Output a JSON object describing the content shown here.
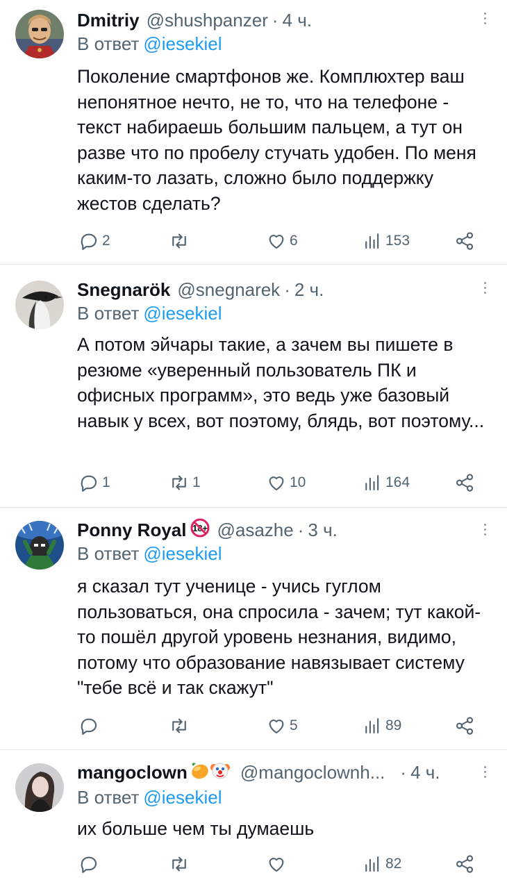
{
  "tweets": [
    {
      "name": "Dmitriy",
      "handle": "@shushpanzer",
      "separator": "·",
      "time": "4 ч.",
      "reply_prefix": "В ответ",
      "reply_mention": "@iesekiel",
      "text": "Поколение смартфонов же. Комплюхтер ваш непонятное нечто, не то, что на телефоне - текст набираешь большим пальцем, а тут он разве что по пробелу стучать удобен. По меня каким-то лазать, сложно было поддержку жестов сделать?",
      "replies": "2",
      "retweets": "",
      "likes": "6",
      "views": "153"
    },
    {
      "name": "Snegnarök",
      "handle": "@snegnarek",
      "separator": "·",
      "time": "2 ч.",
      "reply_prefix": "В ответ",
      "reply_mention": "@iesekiel",
      "text": "А потом эйчары такие, а зачем вы пишете в резюме «уверенный пользователь ПК и офисных программ», это ведь уже базовый навык у всех, вот поэтому, блядь, вот поэтому...",
      "replies": "1",
      "retweets": "1",
      "likes": "10",
      "views": "164"
    },
    {
      "name": "Ponny Royal",
      "badge": "18+",
      "handle": "@asazhe",
      "separator": "·",
      "time": "3 ч.",
      "reply_prefix": "В ответ",
      "reply_mention": "@iesekiel",
      "text": "я сказал тут ученице - учись гуглом пользоваться, она спросила - зачем; тут какой-то пошёл другой уровень незнания, видимо, потому что образование навязывает систему \"тебе всё и так скажут\"",
      "replies": "",
      "retweets": "",
      "likes": "5",
      "views": "89"
    },
    {
      "name": "mangoclown",
      "emoji": [
        "mango",
        "clown"
      ],
      "handle": "@mangoclownh...",
      "separator": "·",
      "time": "4 ч.",
      "reply_prefix": "В ответ",
      "reply_mention": "@iesekiel",
      "text": "их больше чем ты думаешь",
      "replies": "",
      "retweets": "",
      "likes": "",
      "views": "82"
    }
  ],
  "icons": {
    "reply": "reply-icon",
    "retweet": "retweet-icon",
    "like": "heart-icon",
    "views": "views-icon",
    "share": "share-icon",
    "more": "more-icon"
  },
  "colors": {
    "text": "#0f1419",
    "secondary": "#536471",
    "link": "#1d9bf0",
    "divider": "#e6e9eb"
  }
}
